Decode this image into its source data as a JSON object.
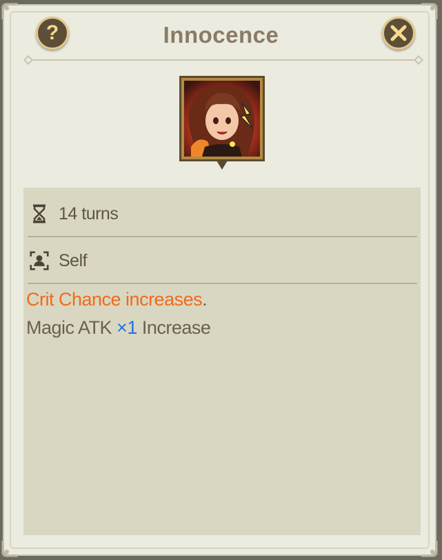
{
  "dialog": {
    "title": "Innocence",
    "help_label": "?",
    "close_icon": "close-x-icon"
  },
  "portrait": {
    "icon": "buff-portrait-icon"
  },
  "info": {
    "turns_icon": "hourglass-icon",
    "turns_text": "14 turns",
    "target_icon": "self-target-icon",
    "target_text": "Self"
  },
  "description": {
    "line1_highlight": "Crit Chance  increases",
    "line1_tail": ".",
    "line2_prefix": "Magic ATK ",
    "line2_multiplier": "×1",
    "line2_suffix": " Increase"
  },
  "colors": {
    "panel": "#ecebdf",
    "content": "#d9d7c2",
    "title": "#8a7a68",
    "highlight": "#ef6b1c",
    "multiplier": "#1f72e0",
    "button": "#5d4e38",
    "button_glyph": "#f6d98f"
  }
}
